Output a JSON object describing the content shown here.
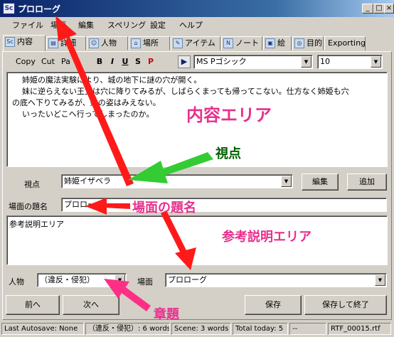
{
  "window": {
    "title": "プロローグ",
    "icon": "Sc"
  },
  "menu": [
    "ファイル",
    "場面",
    "編集",
    "スペリング",
    "設定",
    "ヘルプ"
  ],
  "tabs": [
    {
      "label": "内容",
      "icon": "Sc"
    },
    {
      "label": "詳細",
      "icon": "doc"
    },
    {
      "label": "人物",
      "icon": "person"
    },
    {
      "label": "場所",
      "icon": "building"
    },
    {
      "label": "アイテム",
      "icon": "pencil"
    },
    {
      "label": "ノート",
      "icon": "note"
    },
    {
      "label": "絵",
      "icon": "picture"
    },
    {
      "label": "目的",
      "icon": "target"
    },
    {
      "label": "Exporting",
      "icon": ""
    }
  ],
  "toolbar": {
    "copy": "Copy",
    "cut": "Cut",
    "paste": "Pa",
    "bold": "B",
    "italic": "I",
    "underline": "U",
    "strike": "S",
    "p": "P",
    "font": "MS Pゴシック",
    "size": "10"
  },
  "content": {
    "lines": [
      "姉姫の魔法実験により、城の地下に謎の穴が開く。",
      "妹に逆らえない王女は穴に降りてみるが、しばらくまっても帰ってこない。仕方なく姉姫も穴",
      "の底へ下りてみるが、妹の姿はみえない。",
      "いったいどこへ行ってしまったのか。"
    ]
  },
  "viewpoint": {
    "label": "視点",
    "value": "姉姫イザベラ",
    "edit": "編集",
    "add": "追加"
  },
  "scene_title": {
    "label": "場面の題名",
    "value": "プロローグ"
  },
  "notes": {
    "value": "参考説明エリア"
  },
  "chapter": {
    "label": "人物",
    "value": "（違反・侵犯）"
  },
  "scene": {
    "label": "場面",
    "value": "プロローグ"
  },
  "buttons": {
    "prev": "前へ",
    "next": "次へ",
    "save": "保存",
    "save_exit": "保存して終了"
  },
  "status": {
    "autosave": "Last Autosave: None",
    "chapter_words": "（違反・侵犯）: 6 words",
    "scene_words": "Scene: 3 words",
    "today": "Total today: 5",
    "dash": "--",
    "file": "RTF_00015.rtf"
  },
  "annotations": {
    "content_area": "内容エリア",
    "viewpoint": "視点",
    "scene_title": "場面の題名",
    "notes_area": "参考説明エリア",
    "chapter": "章題"
  },
  "colors": {
    "annotation_pink": "#e8308c",
    "arrow_red": "#ff1a1a",
    "arrow_green": "#33cc33",
    "title_blue": "#0a246a"
  }
}
